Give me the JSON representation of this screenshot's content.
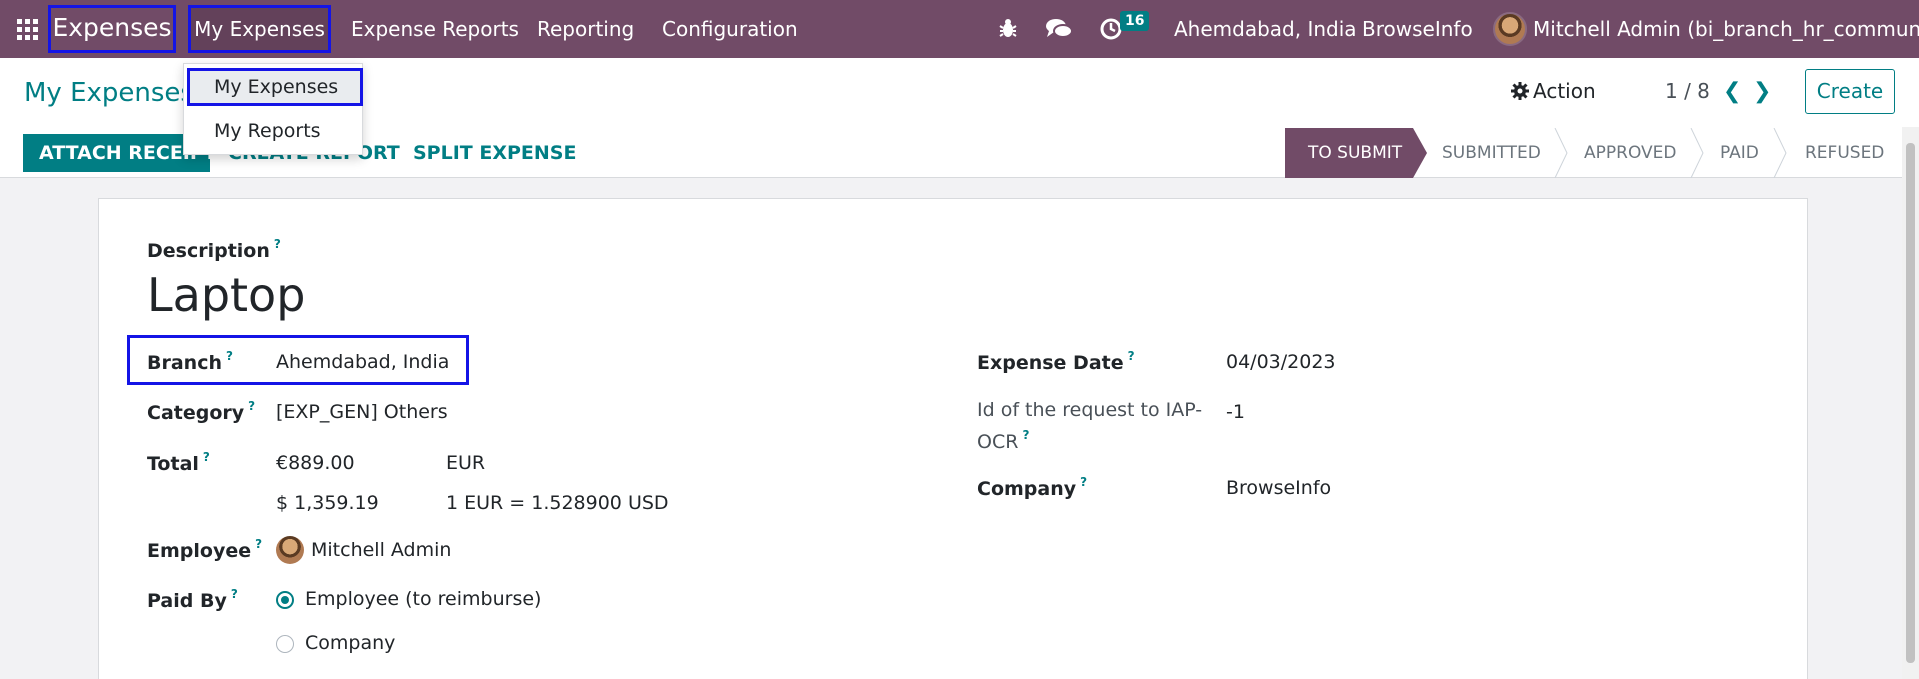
{
  "navbar": {
    "brand": "Expenses",
    "menus": [
      "My Expenses",
      "Expense Reports",
      "Reporting",
      "Configuration"
    ],
    "activity_count": "16",
    "branch": "Ahemdabad, India",
    "company": "BrowseInfo",
    "user": "Mitchell Admin (bi_branch_hr_community)"
  },
  "dropdown": {
    "items": [
      "My Expenses",
      "My Reports"
    ]
  },
  "control_panel": {
    "breadcrumb": "My Expenses",
    "action_label": "Action",
    "pager": "1 / 8",
    "create_label": "Create"
  },
  "buttons": {
    "attach_receipt": "ATTACH RECEIPT",
    "create_report": "CREATE REPORT",
    "split_expense": "SPLIT EXPENSE"
  },
  "status": {
    "stages": [
      "TO SUBMIT",
      "SUBMITTED",
      "APPROVED",
      "PAID",
      "REFUSED"
    ],
    "active": "TO SUBMIT"
  },
  "form": {
    "description_label": "Description",
    "description": "Laptop",
    "branch_label": "Branch",
    "branch": "Ahemdabad, India",
    "category_label": "Category",
    "category": "[EXP_GEN] Others",
    "total_label": "Total",
    "total": "€889.00",
    "currency": "EUR",
    "total_usd": "$ 1,359.19",
    "rate": "1 EUR = 1.528900 USD",
    "employee_label": "Employee",
    "employee": "Mitchell Admin",
    "paid_by_label": "Paid By",
    "paid_by_options": [
      "Employee (to reimburse)",
      "Company"
    ],
    "paid_by_selected": "Employee (to reimburse)",
    "expense_date_label": "Expense Date",
    "expense_date": "04/03/2023",
    "iap_label_1": "Id of the request to IAP-",
    "iap_label_2": "OCR",
    "iap_value": "-1",
    "company_label": "Company",
    "company": "BrowseInfo",
    "help_mark": "?"
  },
  "colors": {
    "navbar": "#714b67",
    "accent": "#017e84",
    "highlight": "#1414e6"
  }
}
